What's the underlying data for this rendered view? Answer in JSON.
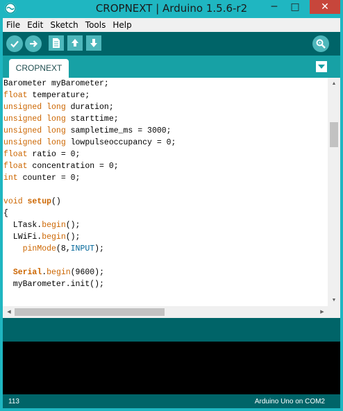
{
  "window": {
    "title": "CROPNEXT | Arduino 1.5.6-r2",
    "minimize": "─",
    "maximize": "□",
    "close": "✕"
  },
  "menu": [
    "File",
    "Edit",
    "Sketch",
    "Tools",
    "Help"
  ],
  "toolbar": {
    "buttons": [
      "verify-icon",
      "upload-icon",
      "new-icon",
      "open-icon",
      "save-icon",
      "serial-monitor-icon"
    ]
  },
  "tab": {
    "label": "CROPNEXT",
    "menu_icon": "tab-menu-icon"
  },
  "code": [
    [
      {
        "t": "Barometer myBarometer;",
        "c": ""
      }
    ],
    [
      {
        "t": "float",
        "c": "kw"
      },
      {
        "t": " temperature;",
        "c": ""
      }
    ],
    [
      {
        "t": "unsigned long",
        "c": "kw"
      },
      {
        "t": " duration;",
        "c": ""
      }
    ],
    [
      {
        "t": "unsigned long",
        "c": "kw"
      },
      {
        "t": " starttime;",
        "c": ""
      }
    ],
    [
      {
        "t": "unsigned long",
        "c": "kw"
      },
      {
        "t": " sampletime_ms = 3000;",
        "c": ""
      }
    ],
    [
      {
        "t": "unsigned long",
        "c": "kw"
      },
      {
        "t": " lowpulseoccupancy = 0;",
        "c": ""
      }
    ],
    [
      {
        "t": "float",
        "c": "kw"
      },
      {
        "t": " ratio = 0;",
        "c": ""
      }
    ],
    [
      {
        "t": "float",
        "c": "kw"
      },
      {
        "t": " concentration = 0;",
        "c": ""
      }
    ],
    [
      {
        "t": "int",
        "c": "kw"
      },
      {
        "t": " counter = 0;",
        "c": ""
      }
    ],
    [],
    [
      {
        "t": "void",
        "c": "kw"
      },
      {
        "t": " ",
        "c": ""
      },
      {
        "t": "setup",
        "c": "kw-bold"
      },
      {
        "t": "()",
        "c": ""
      }
    ],
    [
      {
        "t": "{",
        "c": ""
      }
    ],
    [
      {
        "t": "  LTask.",
        "c": ""
      },
      {
        "t": "begin",
        "c": "kw"
      },
      {
        "t": "();",
        "c": ""
      }
    ],
    [
      {
        "t": "  LWiFi.",
        "c": ""
      },
      {
        "t": "begin",
        "c": "kw"
      },
      {
        "t": "();",
        "c": ""
      }
    ],
    [
      {
        "t": "    ",
        "c": ""
      },
      {
        "t": "pinMode",
        "c": "kw"
      },
      {
        "t": "(8,",
        "c": ""
      },
      {
        "t": "INPUT",
        "c": "const"
      },
      {
        "t": ");",
        "c": ""
      }
    ],
    [],
    [
      {
        "t": "  ",
        "c": ""
      },
      {
        "t": "Serial",
        "c": "kw-bold"
      },
      {
        "t": ".",
        "c": ""
      },
      {
        "t": "begin",
        "c": "kw"
      },
      {
        "t": "(9600);",
        "c": ""
      }
    ],
    [
      {
        "t": "  myBarometer.init();",
        "c": ""
      }
    ]
  ],
  "status": {
    "line": "113",
    "board": "Arduino Uno on COM2"
  },
  "colors": {
    "window_frame": "#1fb6c1",
    "toolbar": "#006468",
    "keyword": "#cc6600",
    "constant": "#006699"
  }
}
